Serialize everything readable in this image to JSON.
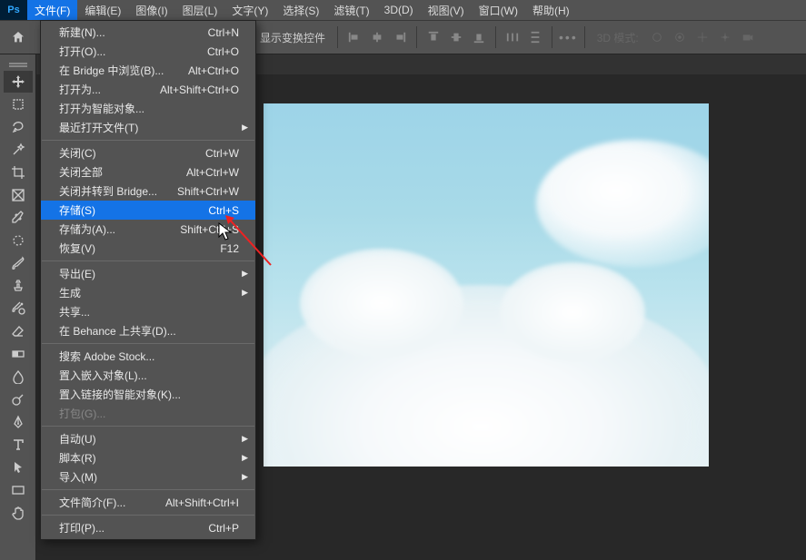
{
  "menubar": {
    "items": [
      {
        "label": "文件(F)",
        "active": true
      },
      {
        "label": "编辑(E)"
      },
      {
        "label": "图像(I)"
      },
      {
        "label": "图层(L)"
      },
      {
        "label": "文字(Y)"
      },
      {
        "label": "选择(S)"
      },
      {
        "label": "滤镜(T)"
      },
      {
        "label": "3D(D)"
      },
      {
        "label": "视图(V)"
      },
      {
        "label": "窗口(W)"
      },
      {
        "label": "帮助(H)"
      }
    ]
  },
  "optbar": {
    "transform_label": "显示变换控件",
    "mode_3d": "3D 模式:"
  },
  "file_menu": {
    "items": [
      {
        "label": "新建(N)...",
        "shortcut": "Ctrl+N"
      },
      {
        "label": "打开(O)...",
        "shortcut": "Ctrl+O"
      },
      {
        "label": "在 Bridge 中浏览(B)...",
        "shortcut": "Alt+Ctrl+O"
      },
      {
        "label": "打开为...",
        "shortcut": "Alt+Shift+Ctrl+O"
      },
      {
        "label": "打开为智能对象..."
      },
      {
        "label": "最近打开文件(T)",
        "submenu": true
      },
      {
        "sep": true
      },
      {
        "label": "关闭(C)",
        "shortcut": "Ctrl+W"
      },
      {
        "label": "关闭全部",
        "shortcut": "Alt+Ctrl+W"
      },
      {
        "label": "关闭并转到 Bridge...",
        "shortcut": "Shift+Ctrl+W"
      },
      {
        "label": "存储(S)",
        "shortcut": "Ctrl+S",
        "highlighted": true
      },
      {
        "label": "存储为(A)...",
        "shortcut": "Shift+Ctrl+S"
      },
      {
        "label": "恢复(V)",
        "shortcut": "F12"
      },
      {
        "sep": true
      },
      {
        "label": "导出(E)",
        "submenu": true
      },
      {
        "label": "生成",
        "submenu": true
      },
      {
        "label": "共享..."
      },
      {
        "label": "在 Behance 上共享(D)..."
      },
      {
        "sep": true
      },
      {
        "label": "搜索 Adobe Stock..."
      },
      {
        "label": "置入嵌入对象(L)..."
      },
      {
        "label": "置入链接的智能对象(K)..."
      },
      {
        "label": "打包(G)...",
        "disabled": true
      },
      {
        "sep": true
      },
      {
        "label": "自动(U)",
        "submenu": true
      },
      {
        "label": "脚本(R)",
        "submenu": true
      },
      {
        "label": "导入(M)",
        "submenu": true
      },
      {
        "sep": true
      },
      {
        "label": "文件简介(F)...",
        "shortcut": "Alt+Shift+Ctrl+I"
      },
      {
        "sep": true
      },
      {
        "label": "打印(P)...",
        "shortcut": "Ctrl+P"
      }
    ]
  },
  "tools": [
    "move",
    "artboard",
    "marquee",
    "lasso",
    "quick-select",
    "crop",
    "frame",
    "eyedropper",
    "spot-heal",
    "brush",
    "clone",
    "history-brush",
    "eraser",
    "gradient",
    "blur",
    "dodge",
    "pen",
    "type",
    "path-select",
    "rectangle",
    "hand"
  ]
}
